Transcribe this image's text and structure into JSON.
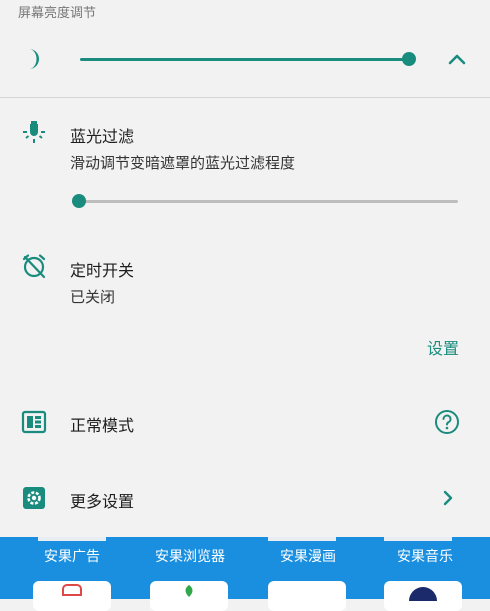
{
  "brightness": {
    "section_label": "屏幕亮度调节",
    "level": 0.995
  },
  "blue_light": {
    "title": "蓝光过滤",
    "subtitle": "滑动调节变暗遮罩的蓝光过滤程度",
    "level": 0.0
  },
  "timer": {
    "title": "定时开关",
    "status": "已关闭",
    "settings_link": "设置"
  },
  "mode": {
    "label": "正常模式"
  },
  "more": {
    "label": "更多设置"
  },
  "apps": [
    {
      "label": "安果广告"
    },
    {
      "label": "安果浏览器"
    },
    {
      "label": "安果漫画"
    },
    {
      "label": "安果音乐"
    }
  ],
  "colors": {
    "accent": "#1a8c7e",
    "app_strip": "#1a8fe0"
  }
}
